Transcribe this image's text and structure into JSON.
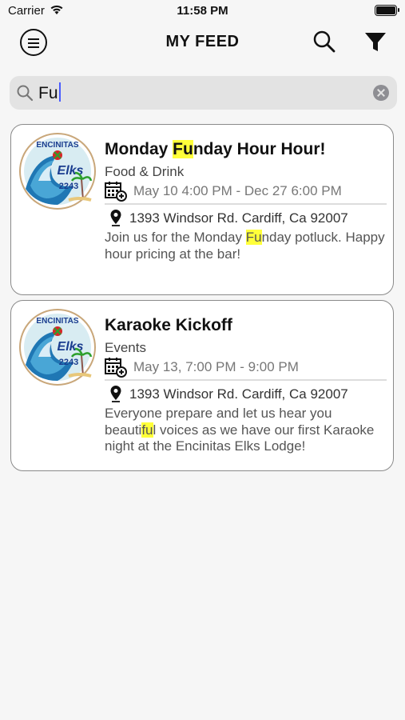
{
  "status_bar": {
    "carrier": "Carrier",
    "time": "11:58 PM"
  },
  "nav": {
    "title": "MY FEED",
    "menu_icon": "menu-icon",
    "search_icon": "search-icon",
    "filter_icon": "filter-icon"
  },
  "search": {
    "query": "Fu",
    "clear_icon": "clear-icon"
  },
  "colors": {
    "highlight": "#ffff3a",
    "accent": "#4a5cff"
  },
  "events": [
    {
      "title_pre": "Monday ",
      "title_hl": "Fu",
      "title_post": "nday Hour Hour!",
      "category": "Food & Drink",
      "date": "May 10 4:00 PM - Dec 27 6:00 PM",
      "address": "1393 Windsor Rd. Cardiff, Ca 92007",
      "desc_pre": "Join us for the Monday ",
      "desc_hl": "Fu",
      "desc_post": "nday potluck. Happy hour pricing at the bar!",
      "logo": {
        "top_text": "ENCINITAS",
        "mid_text": "Elks",
        "number": "2243"
      }
    },
    {
      "title_pre": "Karaoke Kickoff",
      "title_hl": "",
      "title_post": "",
      "category": "Events",
      "date": "May 13, 7:00 PM - 9:00 PM",
      "address": "1393 Windsor Rd. Cardiff, Ca 92007",
      "desc_pre": "Everyone prepare and let us hear you beauti",
      "desc_hl": "fu",
      "desc_post": "l voices as we have our first Karaoke night at the Encinitas Elks Lodge!",
      "logo": {
        "top_text": "ENCINITAS",
        "mid_text": "Elks",
        "number": "2243"
      }
    }
  ]
}
